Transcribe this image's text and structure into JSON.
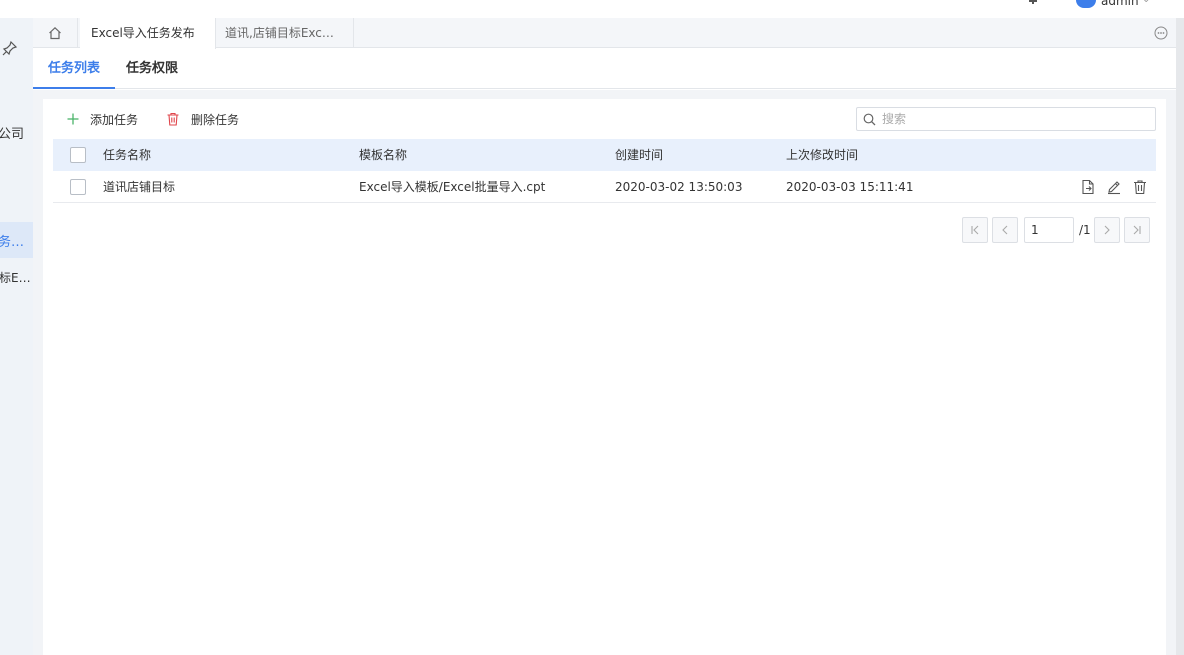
{
  "header": {
    "username": "admin",
    "user_caret": "⌄"
  },
  "sidebar": {
    "items": [
      {
        "label": "公司"
      },
      {
        "label": "务…"
      },
      {
        "label": "标E…"
      }
    ]
  },
  "tabs": [
    {
      "label": "Excel导入任务发布"
    },
    {
      "label": "道讯,店铺目标Exc…"
    }
  ],
  "subtabs": [
    {
      "label": "任务列表"
    },
    {
      "label": "任务权限"
    }
  ],
  "toolbar": {
    "add_label": "添加任务",
    "delete_label": "删除任务",
    "search_placeholder": "搜索"
  },
  "table": {
    "columns": [
      "任务名称",
      "模板名称",
      "创建时间",
      "上次修改时间"
    ],
    "rows": [
      {
        "name": "道讯店铺目标",
        "template": "Excel导入模板/Excel批量导入.cpt",
        "created": "2020-03-02 13:50:03",
        "modified": "2020-03-03 15:11:41"
      }
    ]
  },
  "pagination": {
    "current_page": "1",
    "total_label": "/1"
  },
  "colors": {
    "accent": "#3d7eea",
    "add_icon": "#4bb46a",
    "delete_icon": "#e0454b"
  }
}
